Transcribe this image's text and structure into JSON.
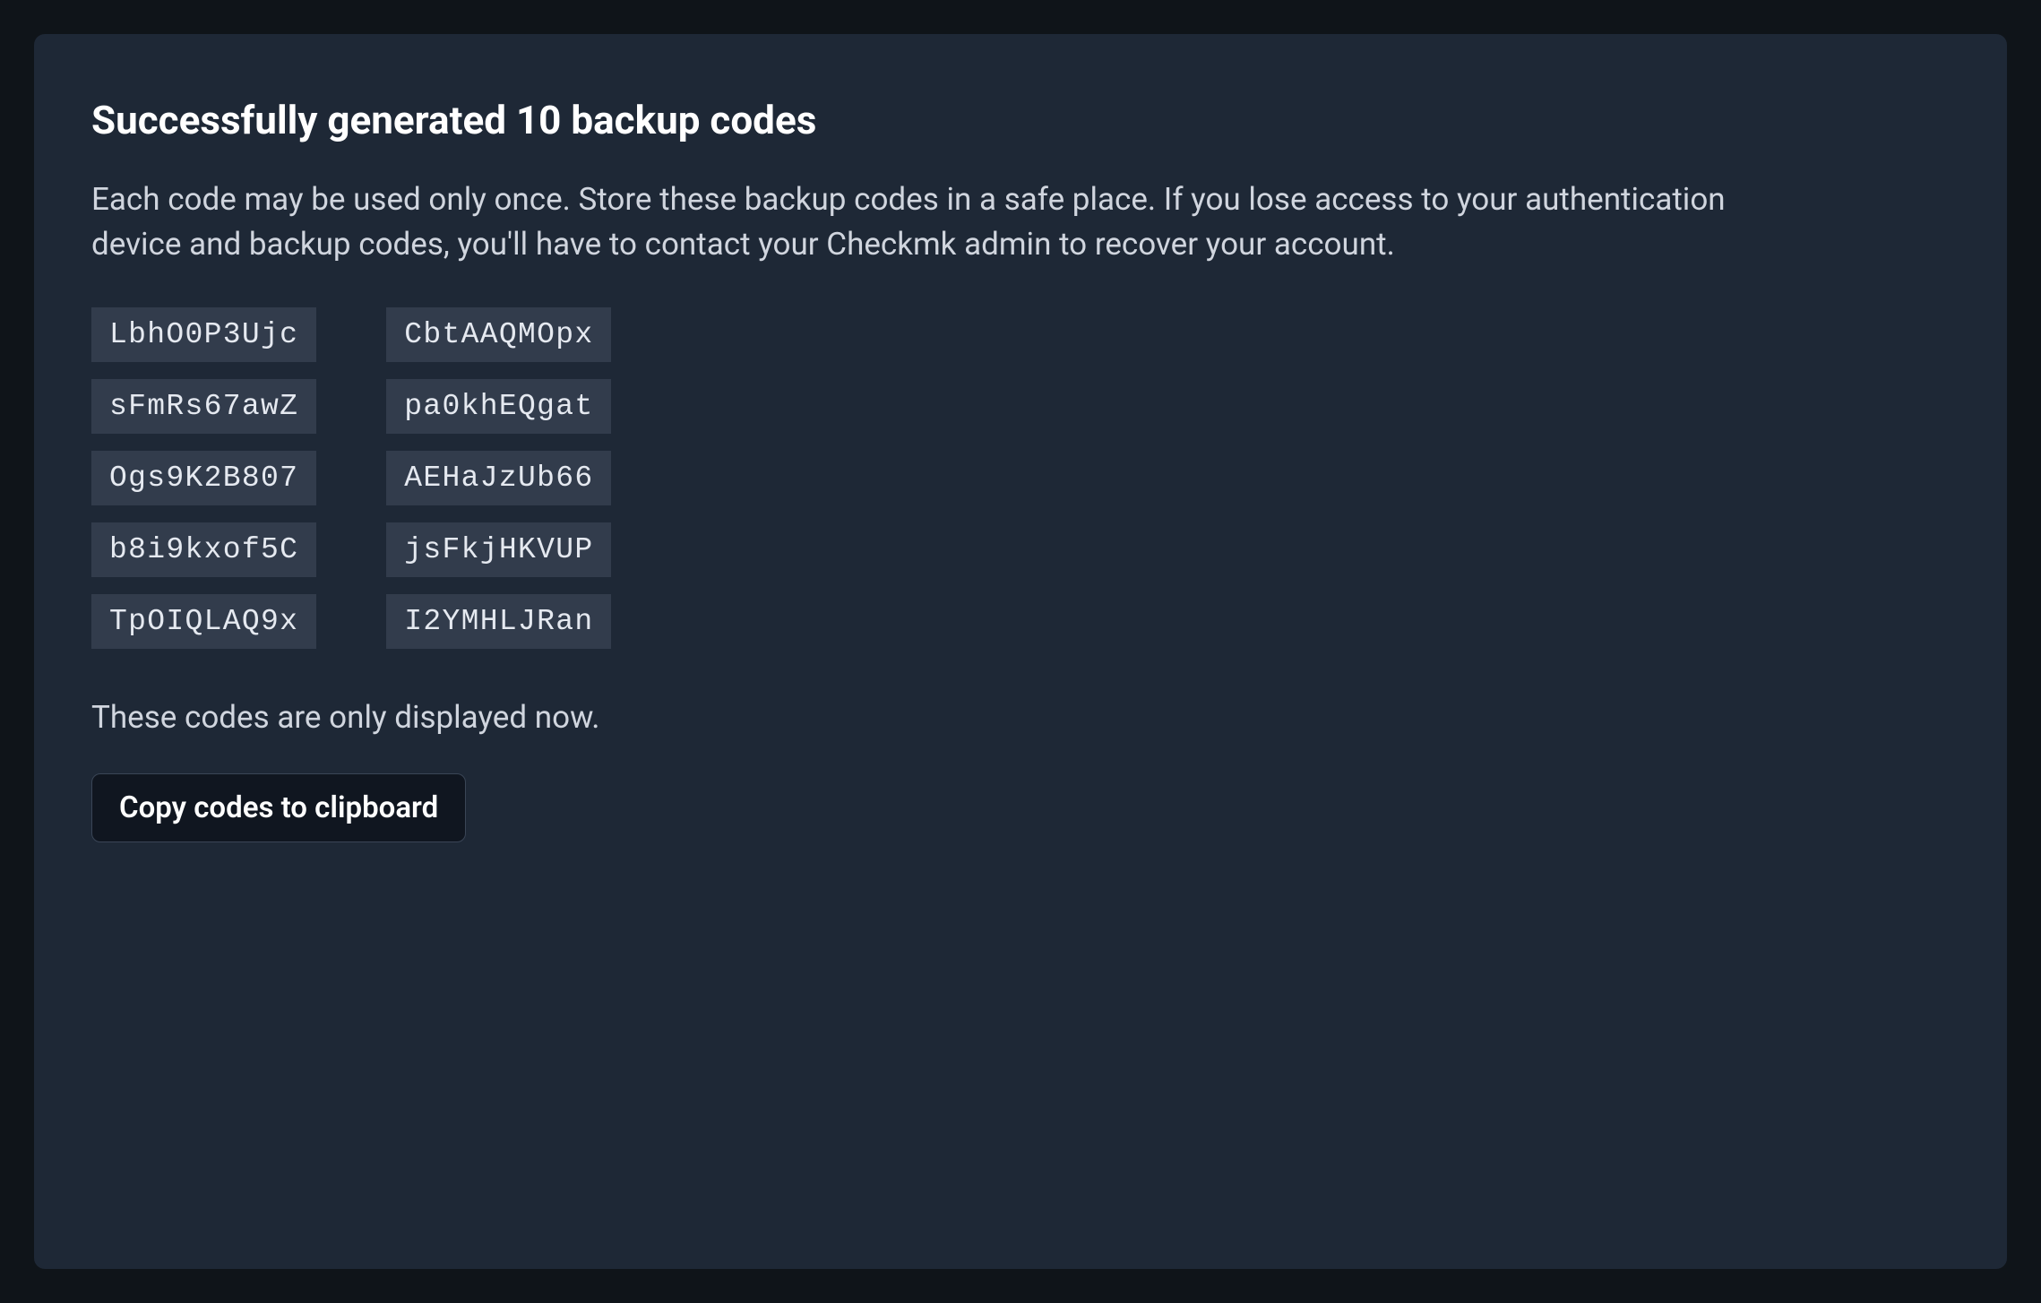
{
  "panel": {
    "title": "Successfully generated 10 backup codes",
    "description": "Each code may be used only once. Store these backup codes in a safe place. If you lose access to your authentication device and backup codes, you'll have to contact your Checkmk admin to recover your account.",
    "codes": [
      "LbhO0P3Ujc",
      "CbtAAQMOpx",
      "sFmRs67awZ",
      "pa0khEQgat",
      "Ogs9K2B807",
      "AEHaJzUb66",
      "b8i9kxof5C",
      "jsFkjHKVUP",
      "TpOIQLAQ9x",
      "I2YMHLJRan"
    ],
    "footnote": "These codes are only displayed now.",
    "copy_button_label": "Copy codes to clipboard"
  }
}
